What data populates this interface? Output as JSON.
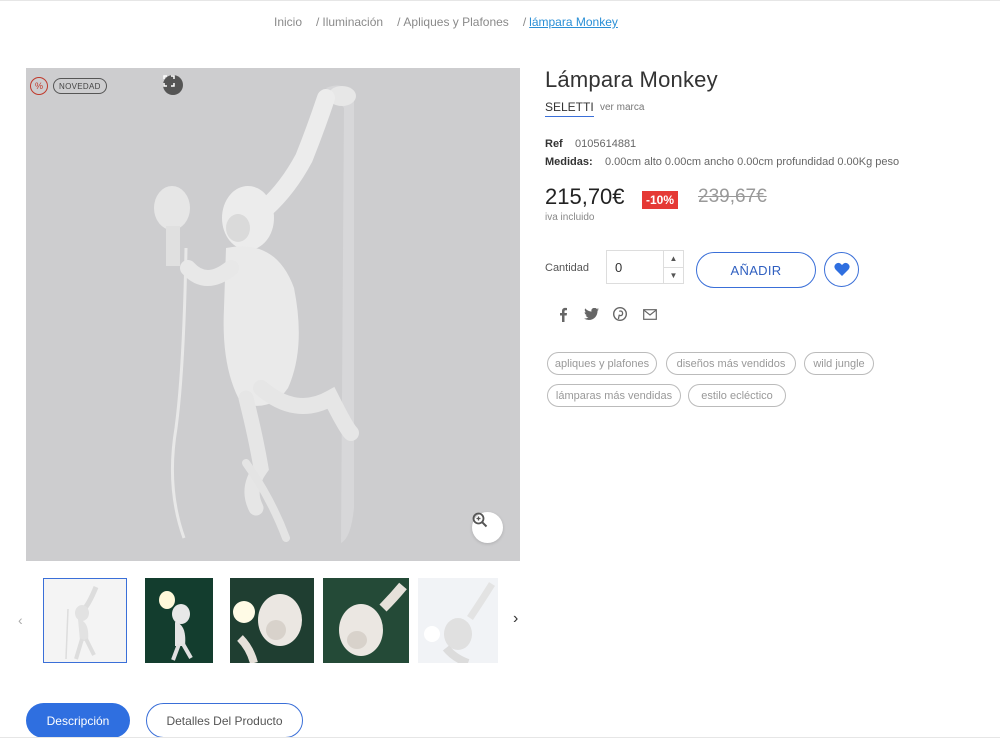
{
  "breadcrumb": {
    "home": "Inicio",
    "level1": "Iluminación",
    "level2": "Apliques y Plafones",
    "current": "lámpara Monkey",
    "separator": "/"
  },
  "badges": {
    "discount_symbol": "%",
    "new": "NOVEDAD"
  },
  "product": {
    "title": "Lámpara Monkey",
    "brand": "SELETTI",
    "brand_link": "ver marca",
    "ref_label": "Ref",
    "ref_value": "0105614881",
    "measures_label": "Medidas:",
    "measures_value": "0.00cm alto  0.00cm ancho  0.00cm profundidad  0.00Kg peso",
    "price": "215,70€",
    "discount": "-10%",
    "old_price": "239,67€",
    "tax_note": "iva incluido"
  },
  "purchase": {
    "quantity_label": "Cantidad",
    "quantity_value": "0",
    "add_label": "AÑADIR"
  },
  "share_icons": [
    "facebook-icon",
    "twitter-icon",
    "pinterest-icon",
    "email-icon"
  ],
  "tags": [
    "apliques y plafones",
    "diseños más vendidos",
    "wild jungle",
    "lámparas más vendidas",
    "estilo ecléctico"
  ],
  "tabs": {
    "description": "Descripción",
    "details": "Detalles Del Producto"
  },
  "colors": {
    "accent": "#2f6fe0",
    "discount": "#e53935",
    "link": "#2a8fd6"
  }
}
